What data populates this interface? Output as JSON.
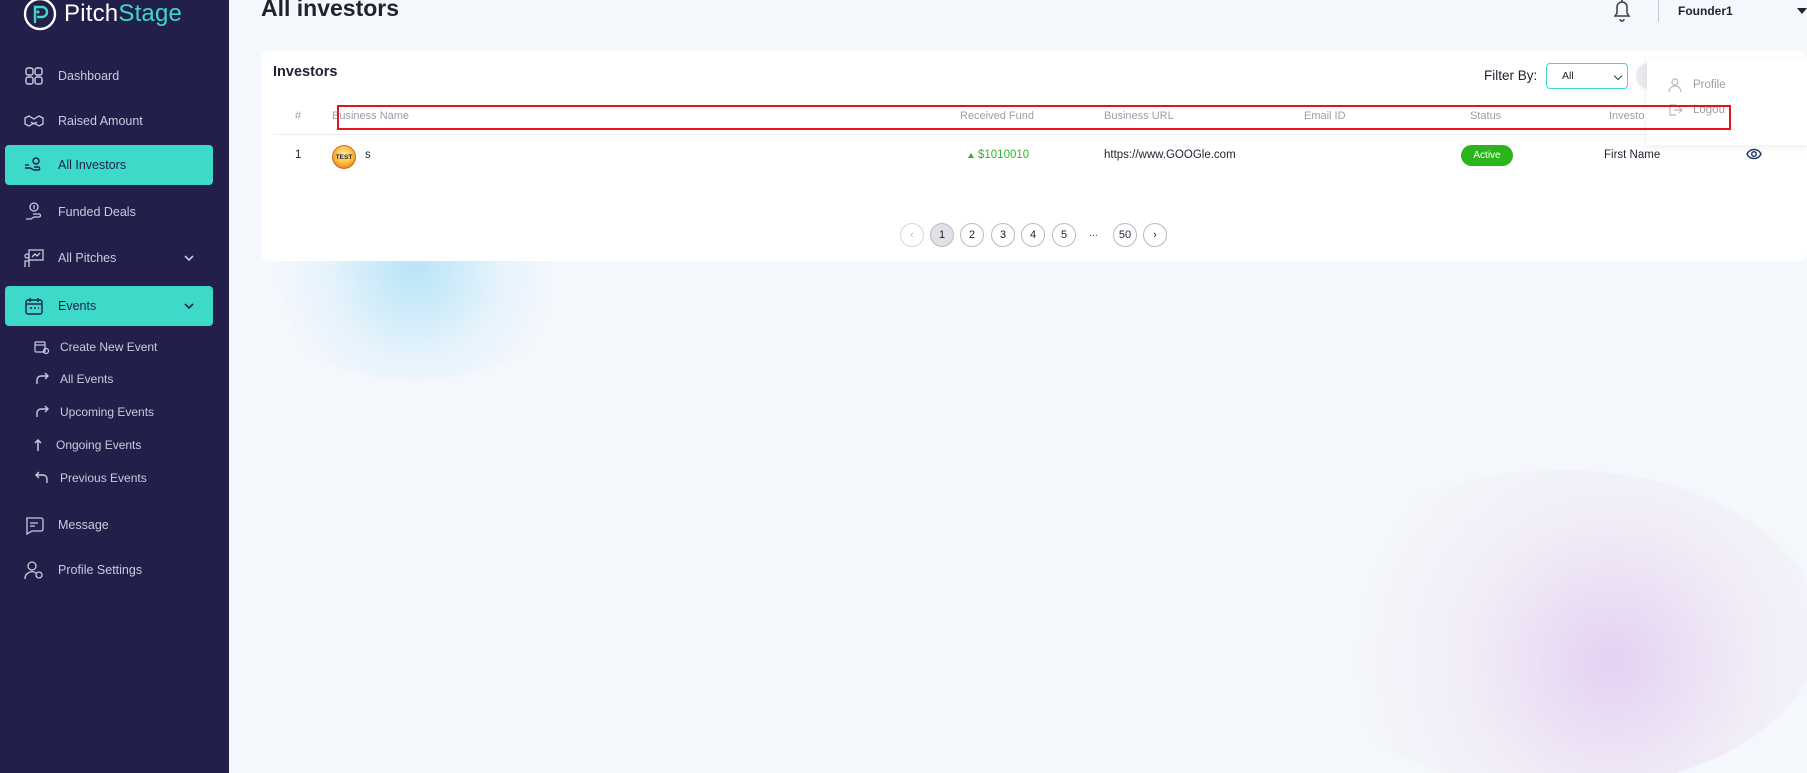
{
  "app": {
    "brand_prefix": "Pitch",
    "brand_suffix": "Stage"
  },
  "sidebar": {
    "items": [
      {
        "label": "Dashboard",
        "icon": "grid-icon"
      },
      {
        "label": "Raised Amount",
        "icon": "handshake-icon"
      },
      {
        "label": "All Investors",
        "icon": "investor-hand-icon",
        "active": true
      },
      {
        "label": "Funded Deals",
        "icon": "money-hand-icon"
      },
      {
        "label": "All Pitches",
        "icon": "presentation-icon"
      },
      {
        "label": "Events",
        "icon": "calendar-icon",
        "active": true
      },
      {
        "label": "Message",
        "icon": "chat-icon"
      },
      {
        "label": "Profile Settings",
        "icon": "user-gear-icon"
      }
    ],
    "events_sub": [
      {
        "label": "Create New Event",
        "icon": "calendar-gear-icon"
      },
      {
        "label": "All Events",
        "icon": "redo-arrow-icon"
      },
      {
        "label": "Upcoming Events",
        "icon": "redo-arrow-icon"
      },
      {
        "label": "Ongoing Events",
        "icon": "up-arrow-icon"
      },
      {
        "label": "Previous Events",
        "icon": "undo-arrow-icon"
      }
    ]
  },
  "header": {
    "title": "All investors",
    "user_name": "Founder1"
  },
  "investors": {
    "title": "Investors",
    "filter_label": "Filter By:",
    "filter_value": "All",
    "columns": [
      "#",
      "Business Name",
      "Received Fund",
      "Business URL",
      "Email ID",
      "Status",
      "Investo"
    ],
    "rows": [
      {
        "index": "1",
        "avatar_text": "TEST",
        "business_name": "s",
        "received_fund": "$1010010",
        "business_url": "https://www.GOOGle.com",
        "email": "",
        "status": "Active",
        "investor": "First Name"
      }
    ]
  },
  "pagination": {
    "prev": "‹",
    "pages": [
      "1",
      "2",
      "3",
      "4",
      "5"
    ],
    "ellipsis": "...",
    "last": "50",
    "next": "›",
    "current": "1"
  },
  "user_menu": {
    "items": [
      "Profile",
      "Logou"
    ]
  },
  "colors": {
    "sidebar": "#221f4a",
    "accent": "#3dd9c9",
    "status_active": "#29b51b",
    "fund_green": "#2fb52f",
    "highlight": "#e8131a"
  }
}
